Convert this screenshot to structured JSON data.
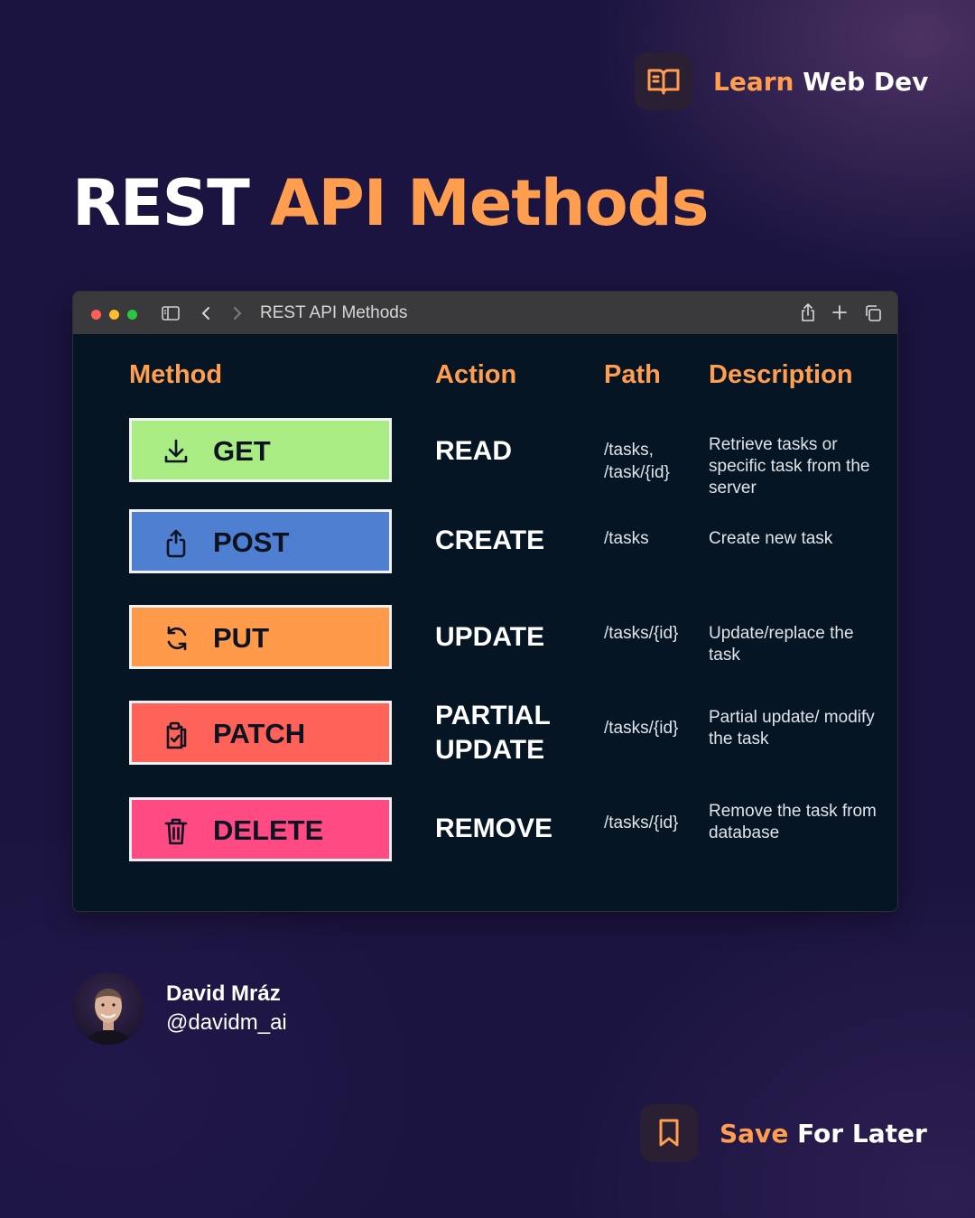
{
  "brand": {
    "accent_word": "Learn",
    "rest": "Web Dev",
    "icon": "open-book-icon"
  },
  "title": {
    "part1": "REST",
    "part2": "API Methods"
  },
  "window": {
    "title": "REST API Methods",
    "columns": [
      "Method",
      "Action",
      "Path",
      "Description"
    ],
    "rows": [
      {
        "method": "GET",
        "color": "#a9ec83",
        "icon": "download-icon",
        "action": "READ",
        "path": [
          "/tasks,",
          "/task/{id}"
        ],
        "description": "Retrieve tasks or specific task from the server"
      },
      {
        "method": "POST",
        "color": "#4f7fd1",
        "icon": "upload-icon",
        "action": "CREATE",
        "path": [
          "/tasks"
        ],
        "description": "Create new task"
      },
      {
        "method": "PUT",
        "color": "#ff9a4a",
        "icon": "refresh-icon",
        "action": "UPDATE",
        "path": [
          "/tasks/{id}"
        ],
        "description": "Update/replace the task"
      },
      {
        "method": "PATCH",
        "color": "#ff6259",
        "icon": "clipboard-check-icon",
        "action": "PARTIAL UPDATE",
        "path": [
          "/tasks/{id}"
        ],
        "description": "Partial update/ modify the task"
      },
      {
        "method": "DELETE",
        "color": "#ff4a83",
        "icon": "trash-icon",
        "action": "REMOVE",
        "path": [
          "/tasks/{id}"
        ],
        "description": "Remove the task from database"
      }
    ]
  },
  "author": {
    "name": "David Mráz",
    "handle": "@davidm_ai"
  },
  "save": {
    "accent_word": "Save",
    "rest": "For Later",
    "icon": "bookmark-icon"
  }
}
